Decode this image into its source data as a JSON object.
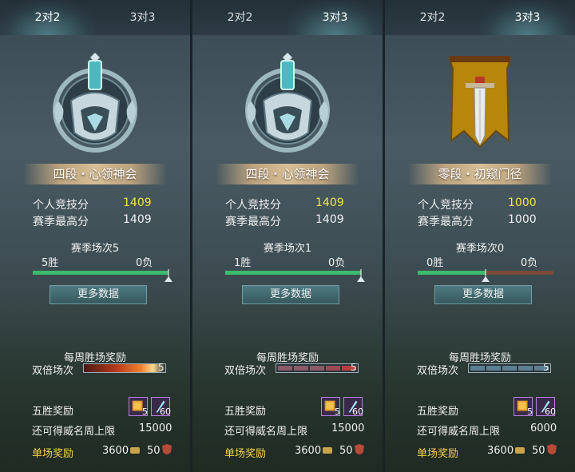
{
  "colors": {
    "highlight_yellow": "#f6e34a",
    "gold_label": "#f6d24a",
    "win_bar": "#3dbb6b",
    "loss_bar": "#7a4a35"
  },
  "panels": [
    {
      "tabs": [
        "2对2",
        "3对3"
      ],
      "active_tab": "2对2",
      "rank_icon": "silver-helmet-rank-emblem",
      "rank_name": "四段・心领神会",
      "personal_score_label": "个人竞技分",
      "personal_score": "1409",
      "season_high_label": "赛季最高分",
      "season_high": "1409",
      "season_matches": "赛季场次5",
      "wins": "5胜",
      "losses": "0负",
      "win_ratio": 1.0,
      "more_button": "更多数据",
      "weekly_reward_title": "每周胜场奖励",
      "double_label": "双倍场次",
      "double_count": "5",
      "double_bar_style": "burning",
      "five_win_label": "五胜奖励",
      "item1_count": "5",
      "item2_count": "60",
      "weekly_cap_label": "还可得威名周上限",
      "weekly_cap": "15000",
      "single_reward_label": "单场奖励",
      "single_reward_coin": "3600",
      "single_reward_shield": "50"
    },
    {
      "tabs": [
        "2对2",
        "3对3"
      ],
      "active_tab": "3对3",
      "rank_icon": "silver-helmet-rank-emblem",
      "rank_name": "四段・心领神会",
      "personal_score_label": "个人竞技分",
      "personal_score": "1409",
      "season_high_label": "赛季最高分",
      "season_high": "1409",
      "season_matches": "赛季场次1",
      "wins": "1胜",
      "losses": "0负",
      "win_ratio": 1.0,
      "more_button": "更多数据",
      "weekly_reward_title": "每周胜场奖励",
      "double_label": "双倍场次",
      "double_count": "5",
      "double_bar_style": "reddish",
      "five_win_label": "五胜奖励",
      "item1_count": "5",
      "item2_count": "60",
      "weekly_cap_label": "还可得威名周上限",
      "weekly_cap": "15000",
      "single_reward_label": "单场奖励",
      "single_reward_coin": "3600",
      "single_reward_shield": "50"
    },
    {
      "tabs": [
        "2对2",
        "3对3"
      ],
      "active_tab": "3对3",
      "rank_icon": "sword-banner-rank-emblem",
      "rank_name": "零段・初窥门径",
      "personal_score_label": "个人竞技分",
      "personal_score": "1000",
      "season_high_label": "赛季最高分",
      "season_high": "1000",
      "season_matches": "赛季场次0",
      "wins": "0胜",
      "losses": "0负",
      "win_ratio": 0.5,
      "more_button": "更多数据",
      "weekly_reward_title": "每周胜场奖励",
      "double_label": "双倍场次",
      "double_count": "5",
      "double_bar_style": "blue",
      "five_win_label": "五胜奖励",
      "item1_count": "5",
      "item2_count": "60",
      "weekly_cap_label": "还可得威名周上限",
      "weekly_cap": "6000",
      "single_reward_label": "单场奖励",
      "single_reward_coin": "3600",
      "single_reward_shield": "50"
    }
  ]
}
